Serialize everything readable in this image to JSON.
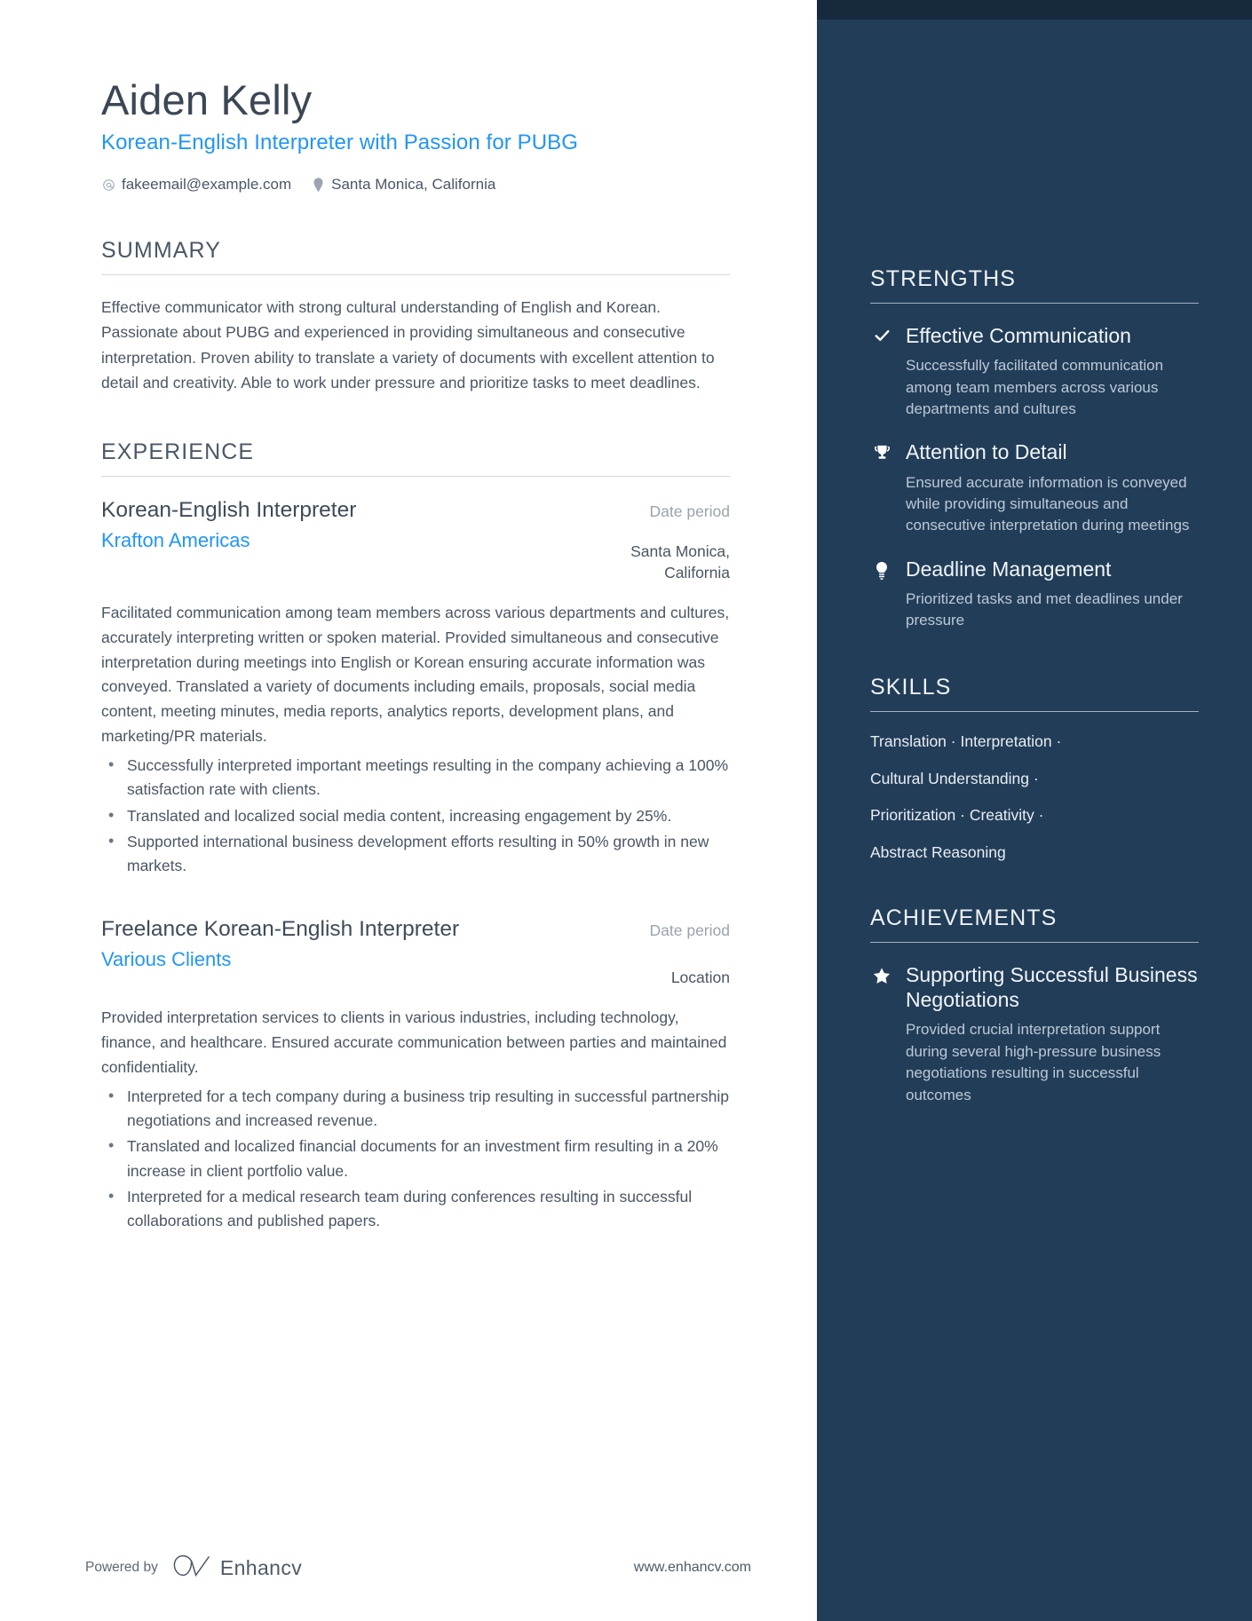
{
  "header": {
    "name": "Aiden Kelly",
    "headline": "Korean-English Interpreter with Passion for PUBG",
    "email": "fakeemail@example.com",
    "location": "Santa Monica, California"
  },
  "summary": {
    "title": "SUMMARY",
    "text": "Effective communicator with strong cultural understanding of English and Korean. Passionate about PUBG and experienced in providing simultaneous and consecutive interpretation. Proven ability to translate a variety of documents with excellent attention to detail and creativity. Able to work under pressure and prioritize tasks to meet deadlines."
  },
  "experience": {
    "title": "EXPERIENCE",
    "jobs": [
      {
        "title": "Korean-English Interpreter",
        "company": "Krafton Americas",
        "date": "Date period",
        "location": "Santa Monica, California",
        "description": "Facilitated communication among team members across various departments and cultures, accurately interpreting written or spoken material. Provided simultaneous and consecutive interpretation during meetings into English or Korean ensuring accurate information was conveyed. Translated a variety of documents including emails, proposals, social media content, meeting minutes, media reports, analytics reports, development plans, and marketing/PR materials.",
        "bullets": [
          "Successfully interpreted important meetings resulting in the company achieving a 100% satisfaction rate with clients.",
          "Translated and localized social media content, increasing engagement by 25%.",
          "Supported international business development efforts resulting in 50% growth in new markets."
        ]
      },
      {
        "title": "Freelance Korean-English Interpreter",
        "company": "Various Clients",
        "date": "Date period",
        "location": "Location",
        "description": "Provided interpretation services to clients in various industries, including technology, finance, and healthcare. Ensured accurate communication between parties and maintained confidentiality.",
        "bullets": [
          "Interpreted for a tech company during a business trip resulting in successful partnership negotiations and increased revenue.",
          "Translated and localized financial documents for an investment firm resulting in a 20% increase in client portfolio value.",
          "Interpreted for a medical research team during conferences resulting in successful collaborations and published papers."
        ]
      }
    ]
  },
  "strengths": {
    "title": "STRENGTHS",
    "items": [
      {
        "icon": "check-icon",
        "title": "Effective Communication",
        "desc": "Successfully facilitated communication among team members across various departments and cultures"
      },
      {
        "icon": "trophy-icon",
        "title": "Attention to Detail",
        "desc": "Ensured accurate information is conveyed while providing simultaneous and consecutive interpretation during meetings"
      },
      {
        "icon": "lightbulb-icon",
        "title": "Deadline Management",
        "desc": "Prioritized tasks and met deadlines under pressure"
      }
    ]
  },
  "skills": {
    "title": "SKILLS",
    "lines": [
      "Translation · Interpretation ·",
      "Cultural Understanding ·",
      "Prioritization · Creativity ·",
      "Abstract Reasoning"
    ]
  },
  "achievements": {
    "title": "ACHIEVEMENTS",
    "items": [
      {
        "icon": "star-icon",
        "title": "Supporting Successful Business Negotiations",
        "desc": "Provided crucial interpretation support during several high-pressure business negotiations resulting in successful outcomes"
      }
    ]
  },
  "footer": {
    "powered_by": "Powered by",
    "brand": "Enhancv",
    "url": "www.enhancv.com"
  },
  "colors": {
    "accent_blue": "#2196f3",
    "sidebar_navy": "#223d58",
    "sidebar_top_strip": "#16293d",
    "heading_gray": "#4a5866"
  }
}
